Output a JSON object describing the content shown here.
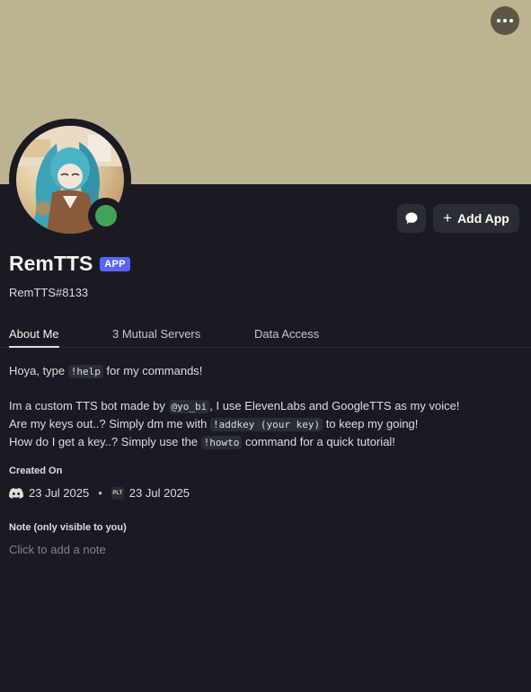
{
  "banner": {
    "color": "#beb391"
  },
  "status": {
    "color": "#43a25a"
  },
  "actions": {
    "add_app_label": "Add App"
  },
  "profile": {
    "display_name": "RemTTS",
    "badge": "APP",
    "username": "RemTTS#8133"
  },
  "tabs": [
    {
      "label": "About Me",
      "active": true
    },
    {
      "label": "3 Mutual Servers",
      "active": false
    },
    {
      "label": "Data Access",
      "active": false
    }
  ],
  "about": {
    "line1_pre": "Hoya, type ",
    "line1_code": "!help",
    "line1_post": " for my commands!",
    "line2_pre": "Im a custom TTS bot made by ",
    "line2_code": "@yo_bi",
    "line2_post": ", I use ElevenLabs and GoogleTTS as my voice!",
    "line3_pre": "Are my keys out..? Simply dm me with ",
    "line3_code": "!addkey (your key)",
    "line3_post": " to keep my going!",
    "line4_pre": "How do I get a key..? Simply use the ",
    "line4_code": "!howto",
    "line4_post": " command for a quick tutorial!"
  },
  "created": {
    "title": "Created On",
    "discord_date": "23 Jul 2025",
    "separator": "•",
    "server_icon_text": "PLT",
    "server_date": "23 Jul 2025"
  },
  "note": {
    "title": "Note (only visible to you)",
    "placeholder": "Click to add a note"
  },
  "icons": {
    "more": "more-dots-icon",
    "message": "message-bubble-icon",
    "plus": "plus-icon",
    "discord": "discord-icon"
  }
}
